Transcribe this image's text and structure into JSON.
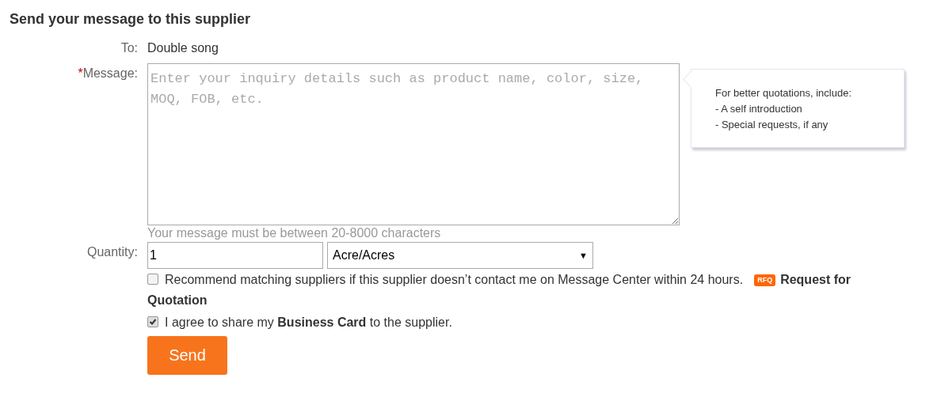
{
  "heading": "Send your message to this supplier",
  "to": {
    "label": "To:",
    "value": "Double song"
  },
  "message": {
    "required_mark": "*",
    "label": "Message:",
    "placeholder": "Enter your inquiry details such as product name, color, size, MOQ, FOB, etc.",
    "hint": "Your message must be between 20-8000 characters"
  },
  "tip": {
    "lines": [
      "For better quotations, include:",
      "- A self introduction",
      "- Special requests, if any"
    ]
  },
  "quantity": {
    "label": "Quantity:",
    "value": "1",
    "unit": "Acre/Acres",
    "caret": "▼"
  },
  "options": [
    {
      "kind": "recommend",
      "checked": false,
      "text": "Recommend matching suppliers if this supplier doesn’t contact me on Message Center within 24 hours.",
      "badge": "RFQ",
      "link": "Request for Quotation"
    },
    {
      "kind": "agree",
      "checked": true,
      "text": "I agree to share my **Business Card** to the supplier."
    }
  ],
  "send_button": "Send"
}
